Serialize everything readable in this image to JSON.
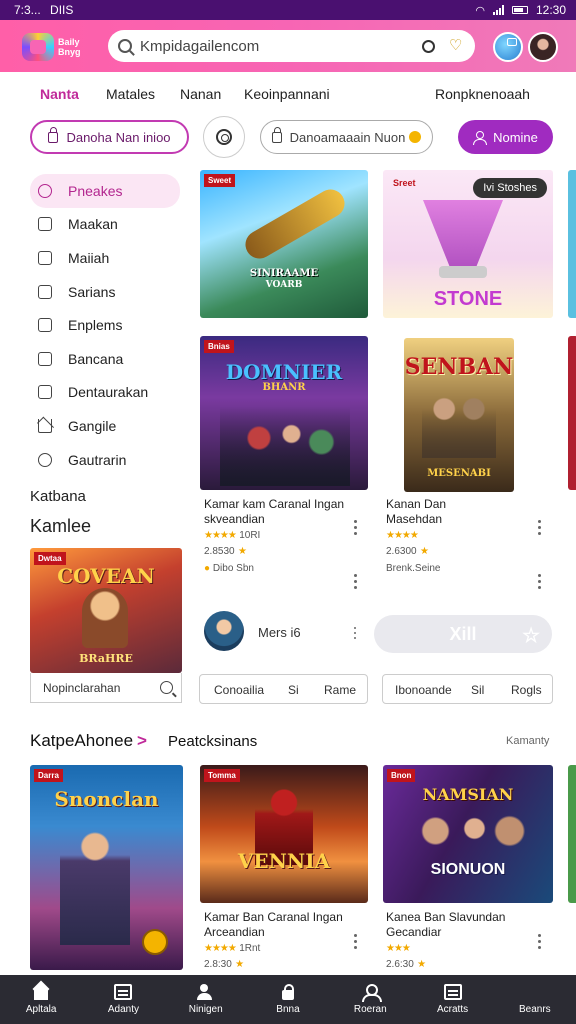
{
  "status_bar": {
    "time_left": "7:3...",
    "carrier": "DIIS",
    "time_right": "12:30"
  },
  "header": {
    "logo_text_1": "Baily",
    "logo_text_2": "Bnyg",
    "search_value": "Kmpidagailencom"
  },
  "top_nav": [
    "Nanta",
    "Matales",
    "Nanan",
    "Keoinpannani",
    "Ronpknenoaah"
  ],
  "filters": {
    "pill_left": "Danoha Nan inioo",
    "pill_center": "Danoamaaain Nuon",
    "pill_right": "Nomine"
  },
  "sidebar": {
    "items": [
      "Pneakes",
      "Maakan",
      "Maiiah",
      "Sarians",
      "Enplems",
      "Bancana",
      "Dentaurakan",
      "Gangile",
      "Gautrarin"
    ],
    "heading_1": "Katbana",
    "heading_2": "Kamlee",
    "card_title": "COVEAN",
    "card_tag": "Dwtaa",
    "card_caption": "BRaHRE",
    "search_label": "Nopinclarahan"
  },
  "grid": {
    "card1": {
      "tag": "Sweet",
      "art_text": "SINIRAAME",
      "art_sub": "VOARB"
    },
    "card2": {
      "tag": "Sreet",
      "badge": "Ivi Stoshes",
      "art_text": "STONE"
    },
    "card3": {
      "tag": "Bnias",
      "art_text": "DOMNIER",
      "art_sub": "BHANR",
      "title": "Kamar kam Caranal Ingan",
      "subtitle": "skveandian",
      "rating_text": "10RI",
      "views": "2.8530",
      "status": "Dibo Sbn"
    },
    "card4": {
      "art_text": "SENBAN",
      "art_sub": "MESENABI",
      "title": "Kanan Dan",
      "subtitle": "Masehdan",
      "views": "2.6300",
      "status": "Brenk.Seine"
    }
  },
  "user_row": {
    "name": "Mers i6",
    "button_label": "Xill"
  },
  "segments": {
    "left": [
      "Conoailia",
      "Si",
      "Rame"
    ],
    "right": [
      "Ibonoande",
      "Sil",
      "Rogls"
    ]
  },
  "section": {
    "title": "KatpeAhonee",
    "arrow": ">",
    "subtitle": "Peatcksinans",
    "link": "Kamanty"
  },
  "bottom_row": {
    "card1": {
      "tag": "Darra",
      "art_text": "Snonclan"
    },
    "card2": {
      "tag": "Tomma",
      "art_text": "VENNIA",
      "title": "Kamar Ban Caranal Ingan",
      "subtitle": "Arceandian",
      "rating_text": "1Rnt",
      "views": "2.8:30"
    },
    "card3": {
      "tag": "Bnon",
      "art_text": "NAMSIAN",
      "art_sub": "SIONUON",
      "title": "Kanea Ban Slavundan",
      "subtitle": "Gecandiar",
      "views": "2.6:30"
    }
  },
  "bottom_nav": [
    "Apltala",
    "Adanty",
    "Ninigen",
    "Bnna",
    "Roeran",
    "Acratts",
    "Beanrs"
  ],
  "colors": {
    "header_start": "#ff5fa8",
    "accent": "#c02a9a",
    "button_purple": "#a02bc0",
    "status_bar": "#4a1070",
    "bottom_nav": "#2b2b33"
  }
}
